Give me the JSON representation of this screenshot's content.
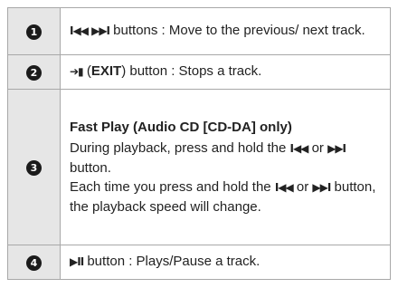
{
  "rows": [
    {
      "number": "1",
      "icons": [
        "prev-track-icon",
        "next-track-icon"
      ],
      "prev_glyph": "I◀◀",
      "next_glyph": "▶▶I",
      "text": " buttons : Move to the previous/ next track."
    },
    {
      "number": "2",
      "icon": "exit-icon",
      "exit_glyph": "➔▮",
      "label_open": " (",
      "label_bold": "EXIT",
      "label_close": ") button : Stops a track."
    },
    {
      "number": "3",
      "heading": "Fast Play (Audio CD [CD-DA] only)",
      "line1_before": "During playback, press and hold the ",
      "line1_mid": " or ",
      "line1_after": " button.",
      "line2_before": "Each time you press and hold the ",
      "line2_mid": " or ",
      "line2_after": " button, the playback speed will change.",
      "prev_glyph": "I◀◀",
      "next_glyph": "▶▶I"
    },
    {
      "number": "4",
      "icon": "play-pause-icon",
      "play_glyph": "▶II",
      "text": " button : Plays/Pause a track."
    }
  ]
}
